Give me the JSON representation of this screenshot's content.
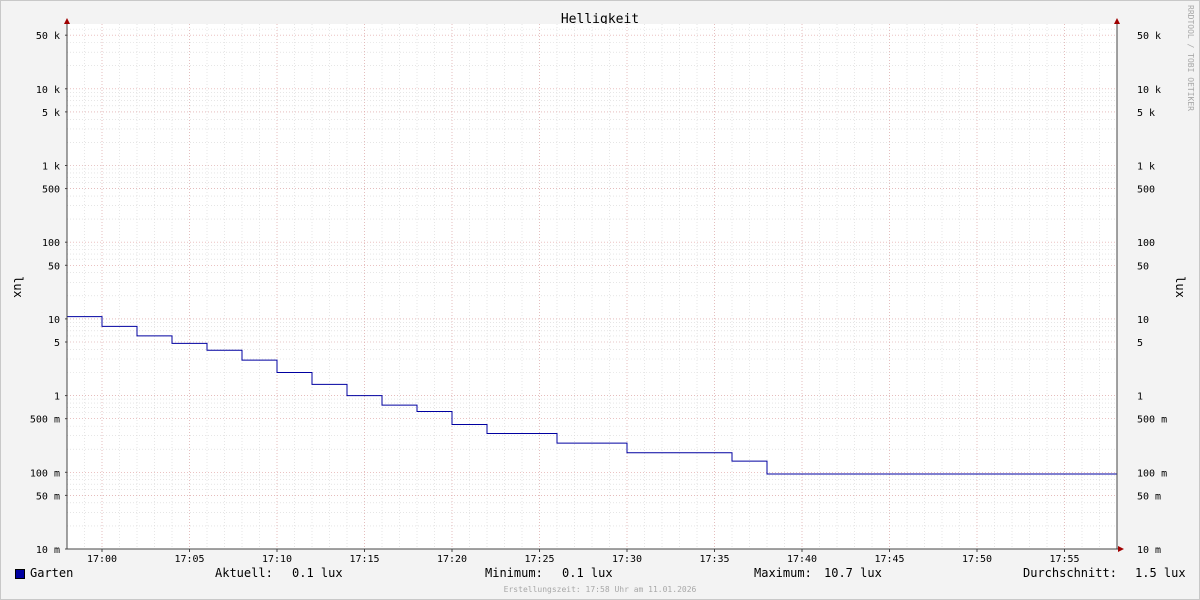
{
  "chart_data": {
    "type": "line",
    "title": "Helligkeit",
    "ylabel": "lux",
    "ylabel_right": "lux",
    "y_scale": "log",
    "ylim": [
      10,
      80000
    ],
    "xlim": [
      "16:58",
      "17:58"
    ],
    "grid": true,
    "y_tick_labels": [
      "50 k",
      "10 k",
      "5 k",
      "1 k",
      "500",
      "100",
      "50",
      "10",
      "5",
      "1",
      "500 m",
      "100 m",
      "50 m",
      "10 m"
    ],
    "x_tick_labels": [
      "17:00",
      "17:05",
      "17:10",
      "17:15",
      "17:20",
      "17:25",
      "17:30",
      "17:35",
      "17:40",
      "17:45",
      "17:50",
      "17:55"
    ],
    "series": [
      {
        "name": "Garten",
        "color": "#0000a0",
        "step": true,
        "x": [
          "16:58",
          "17:00",
          "17:02",
          "17:04",
          "17:06",
          "17:08",
          "17:10",
          "17:12",
          "17:14",
          "17:16",
          "17:18",
          "17:20",
          "17:22",
          "17:26",
          "17:30",
          "17:36",
          "17:38",
          "17:58"
        ],
        "y": [
          10.7,
          8,
          6,
          4.8,
          3.9,
          2.9,
          2.0,
          1.4,
          1.0,
          0.75,
          0.62,
          0.42,
          0.32,
          0.24,
          0.18,
          0.14,
          0.095,
          0.095
        ]
      }
    ],
    "watermark": "RRDTOOL / TOBI OETIKER"
  },
  "legend": {
    "series_name": "Garten",
    "current_label": "Aktuell:",
    "current_value": "0.1 lux",
    "min_label": "Minimum:",
    "min_value": "0.1 lux",
    "max_label": "Maximum:",
    "max_value": "10.7 lux",
    "avg_label": "Durchschnitt:",
    "avg_value": "1.5 lux"
  },
  "footer": {
    "created": "Erstellungszeit: 17:58 Uhr am 11.01.2026"
  }
}
